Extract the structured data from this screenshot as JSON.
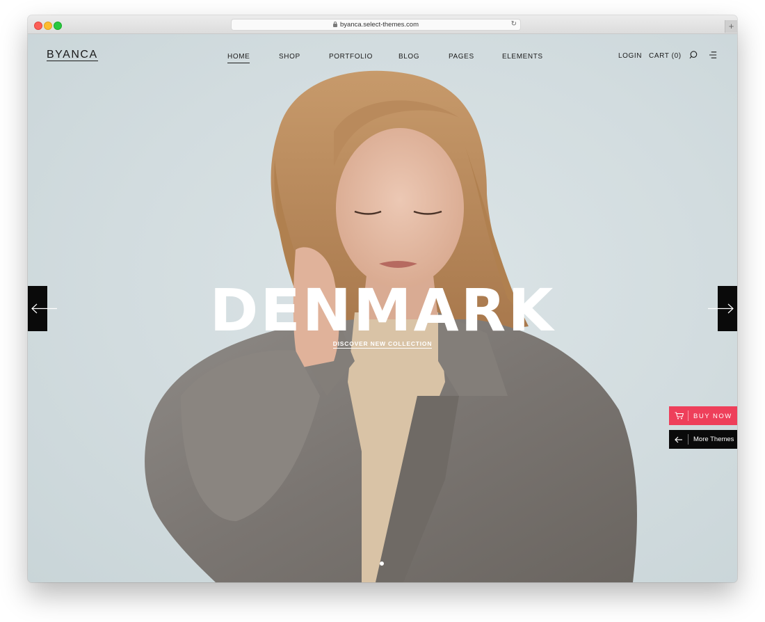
{
  "browser": {
    "url": "byanca.select-themes.com",
    "reload_icon": "reload-icon",
    "new_tab": "+"
  },
  "header": {
    "logo": "BYANCA",
    "nav": [
      {
        "label": "HOME",
        "active": true
      },
      {
        "label": "SHOP"
      },
      {
        "label": "PORTFOLIO"
      },
      {
        "label": "BLOG"
      },
      {
        "label": "PAGES"
      },
      {
        "label": "ELEMENTS"
      }
    ],
    "login": "LOGIN",
    "cart": "CART (0)",
    "search_icon": "search-icon",
    "menu_icon": "menu-icon"
  },
  "hero": {
    "title": "DENMARK",
    "link": "DISCOVER NEW COLLECTION",
    "prev_icon": "arrow-left-icon",
    "next_icon": "arrow-right-icon"
  },
  "side_buttons": {
    "buy_now": "BUY NOW",
    "buy_icon": "cart-icon",
    "more_themes": "More Themes",
    "more_icon": "arrow-left-icon"
  },
  "colors": {
    "accent": "#ee3f5a",
    "dark": "#0a0a0a",
    "background": "#d3dee0"
  }
}
